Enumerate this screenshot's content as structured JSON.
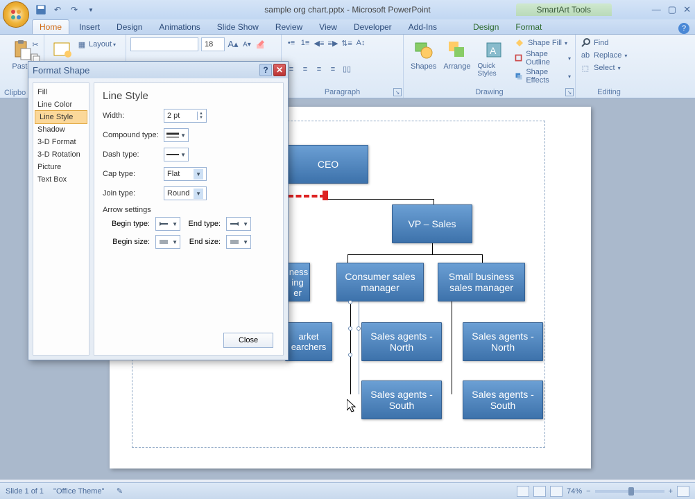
{
  "app": {
    "title": "sample org chart.pptx - Microsoft PowerPoint",
    "context_title": "SmartArt Tools"
  },
  "tabs": {
    "home": "Home",
    "insert": "Insert",
    "design": "Design",
    "animations": "Animations",
    "slideshow": "Slide Show",
    "review": "Review",
    "view": "View",
    "developer": "Developer",
    "addins": "Add-Ins",
    "sa_design": "Design",
    "sa_format": "Format"
  },
  "ribbon": {
    "clipboard": {
      "label": "Clipboard",
      "paste": "Paste"
    },
    "slides": {
      "layout": "Layout"
    },
    "font": {
      "size": "18"
    },
    "paragraph": {
      "label": "Paragraph"
    },
    "drawing": {
      "label": "Drawing",
      "shapes": "Shapes",
      "arrange": "Arrange",
      "quick": "Quick Styles",
      "fill": "Shape Fill",
      "outline": "Shape Outline",
      "effects": "Shape Effects"
    },
    "editing": {
      "label": "Editing",
      "find": "Find",
      "replace": "Replace",
      "select": "Select"
    }
  },
  "dialog": {
    "title": "Format Shape",
    "nav": {
      "fill": "Fill",
      "linecolor": "Line Color",
      "linestyle": "Line Style",
      "shadow": "Shadow",
      "fmt3d": "3-D Format",
      "rot3d": "3-D Rotation",
      "picture": "Picture",
      "textbox": "Text Box"
    },
    "panel": {
      "title": "Line Style",
      "width_label": "Width:",
      "width_value": "2 pt",
      "compound_label": "Compound type:",
      "dash_label": "Dash type:",
      "cap_label": "Cap type:",
      "cap_value": "Flat",
      "join_label": "Join type:",
      "join_value": "Round",
      "arrow_section": "Arrow settings",
      "begin_type": "Begin type:",
      "end_type": "End type:",
      "begin_size": "Begin size:",
      "end_size": "End size:",
      "close": "Close"
    }
  },
  "org": {
    "ceo": "CEO",
    "vp_sales": "VP – Sales",
    "biz_mgr": "Business marketing manager",
    "biz_mgr_cut": "iness\ning\ner",
    "cons_mgr": "Consumer sales manager",
    "sb_mgr": "Small business sales manager",
    "market_res_cut": "arket\nearchers",
    "agents_n": "Sales agents - North",
    "agents_s": "Sales agents - South"
  },
  "status": {
    "slide": "Slide 1 of 1",
    "theme": "\"Office Theme\"",
    "zoom": "74%"
  }
}
